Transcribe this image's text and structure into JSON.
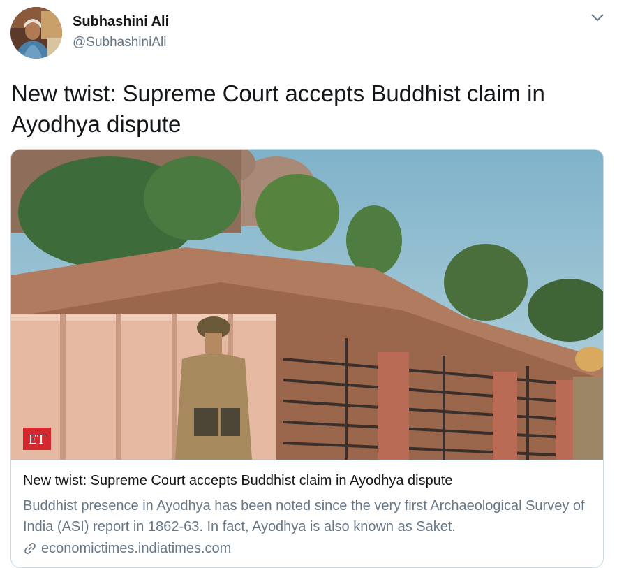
{
  "tweet": {
    "author": {
      "display_name": "Subhashini Ali",
      "handle": "@SubhashiniAli"
    },
    "text": "New twist: Supreme Court accepts Buddhist claim in Ayodhya dispute",
    "menu_icon": "chevron-down-icon",
    "card": {
      "image_logo": "ET",
      "title": "New twist: Supreme Court accepts Buddhist claim in Ayodhya dispute",
      "description": "Buddhist presence in Ayodhya has been noted since the very first Archaeological Survey of India (ASI) report in 1862-63. In fact, Ayodhya is also known as Saket.",
      "domain": "economictimes.indiatimes.com",
      "domain_icon": "link-icon"
    }
  },
  "colors": {
    "primary_text": "#14171a",
    "secondary_text": "#657786",
    "border": "#ccd6dd",
    "et_logo_red": "#d2282e"
  }
}
